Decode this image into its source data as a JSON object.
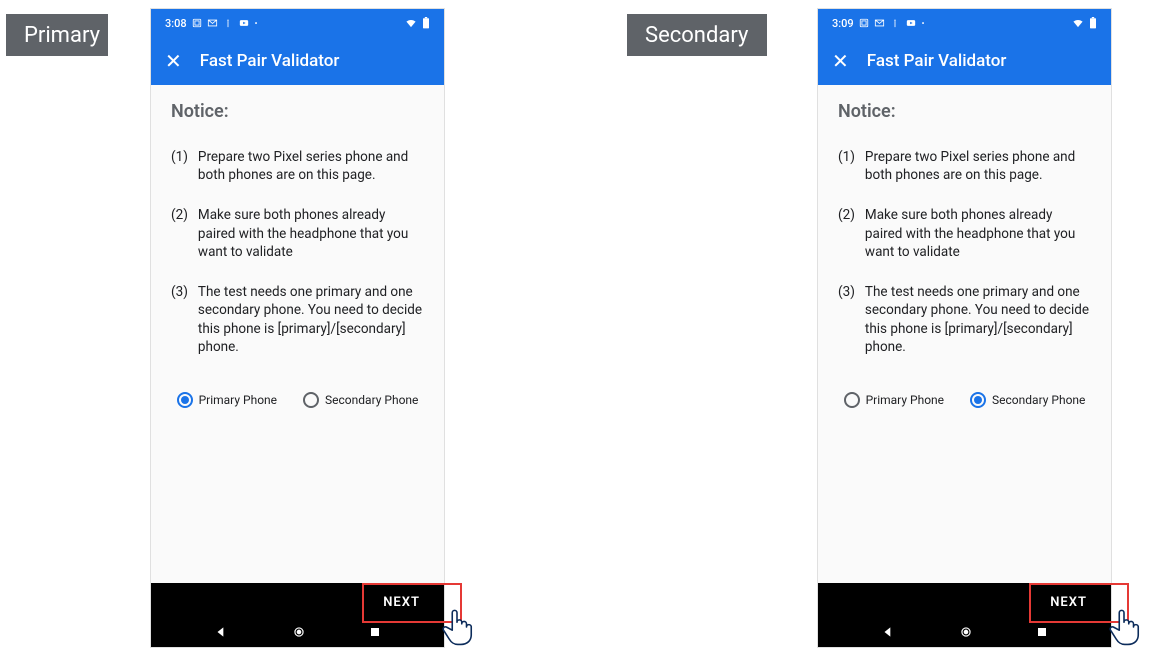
{
  "labels": {
    "primary": "Primary",
    "secondary": "Secondary"
  },
  "colors": {
    "brand": "#1a73e8",
    "tag_bg": "#5f6368",
    "highlight": "#e53935"
  },
  "phone_primary": {
    "status": {
      "time": "3:08"
    },
    "title": "Fast Pair Validator",
    "notice_heading": "Notice:",
    "steps": [
      {
        "num": "(1)",
        "text": "Prepare two Pixel series phone and both phones are on this page."
      },
      {
        "num": "(2)",
        "text": "Make sure both phones already paired with the headphone that you want to validate"
      },
      {
        "num": "(3)",
        "text": "The test needs one primary and one secondary phone. You need to decide this phone is [primary]/[secondary] phone."
      }
    ],
    "radio": {
      "primary_label": "Primary Phone",
      "secondary_label": "Secondary Phone",
      "selected": "primary"
    },
    "next_label": "NEXT"
  },
  "phone_secondary": {
    "status": {
      "time": "3:09"
    },
    "title": "Fast Pair Validator",
    "notice_heading": "Notice:",
    "steps": [
      {
        "num": "(1)",
        "text": "Prepare two Pixel series phone and both phones are on this page."
      },
      {
        "num": "(2)",
        "text": "Make sure both phones already paired with the headphone that you want to validate"
      },
      {
        "num": "(3)",
        "text": "The test needs one primary and one secondary phone. You need to decide this phone is [primary]/[secondary] phone."
      }
    ],
    "radio": {
      "primary_label": "Primary Phone",
      "secondary_label": "Secondary Phone",
      "selected": "secondary"
    },
    "next_label": "NEXT"
  }
}
